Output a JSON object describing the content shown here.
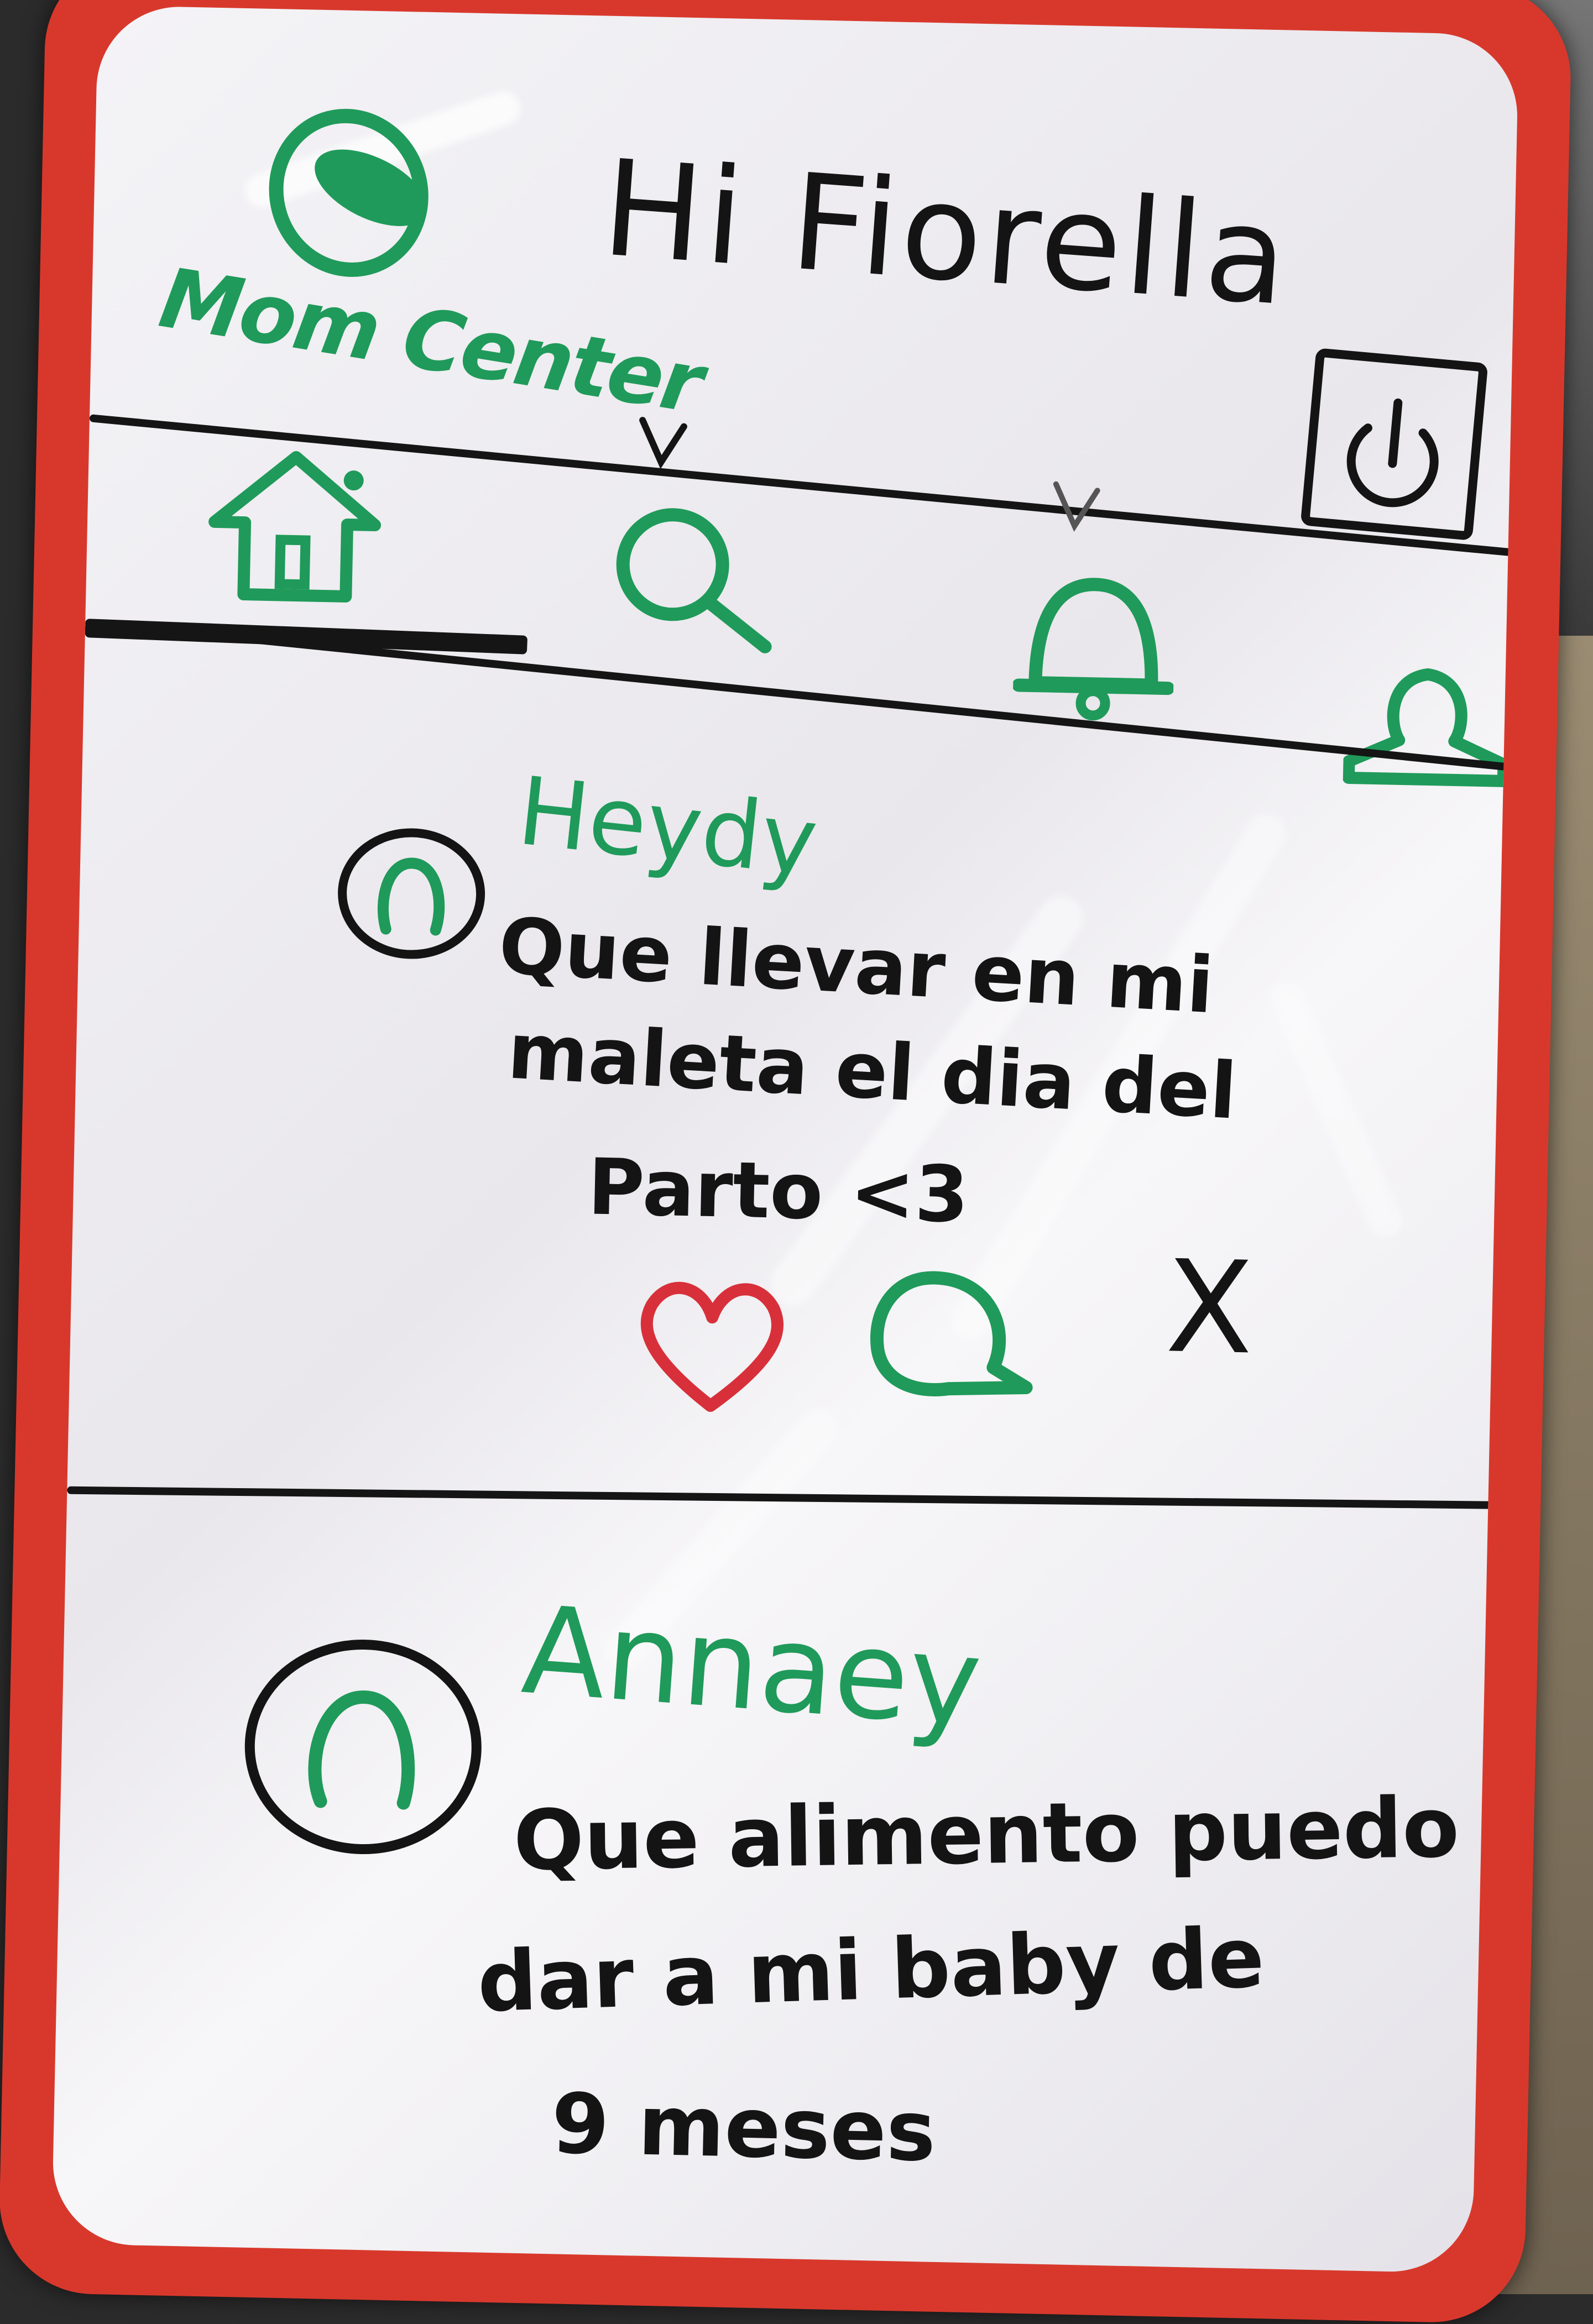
{
  "header": {
    "greeting": "Hi Fiorella",
    "brand_name": "Mom Center"
  },
  "nav": {
    "items": [
      {
        "icon": "home-icon"
      },
      {
        "icon": "search-icon"
      },
      {
        "icon": "bell-icon"
      },
      {
        "icon": "profile-icon"
      }
    ]
  },
  "power_button": {
    "icon": "power-icon"
  },
  "posts": [
    {
      "author": "Heydy",
      "lines": [
        "Que llevar en mi",
        "maleta el dia del",
        "Parto <3"
      ],
      "actions": {
        "like_icon": "heart-icon",
        "comment_icon": "comment-icon",
        "dismiss_label": "X"
      }
    },
    {
      "author": "Annaey",
      "lines": [
        "Que alimento puedo",
        "dar a mi baby de",
        "9 meses"
      ]
    }
  ],
  "colors": {
    "marker_green": "#1f9a5a",
    "marker_black": "#141414",
    "marker_red": "#d8303a",
    "frame_red": "#d8382c",
    "board_white": "#f1f0f3"
  }
}
